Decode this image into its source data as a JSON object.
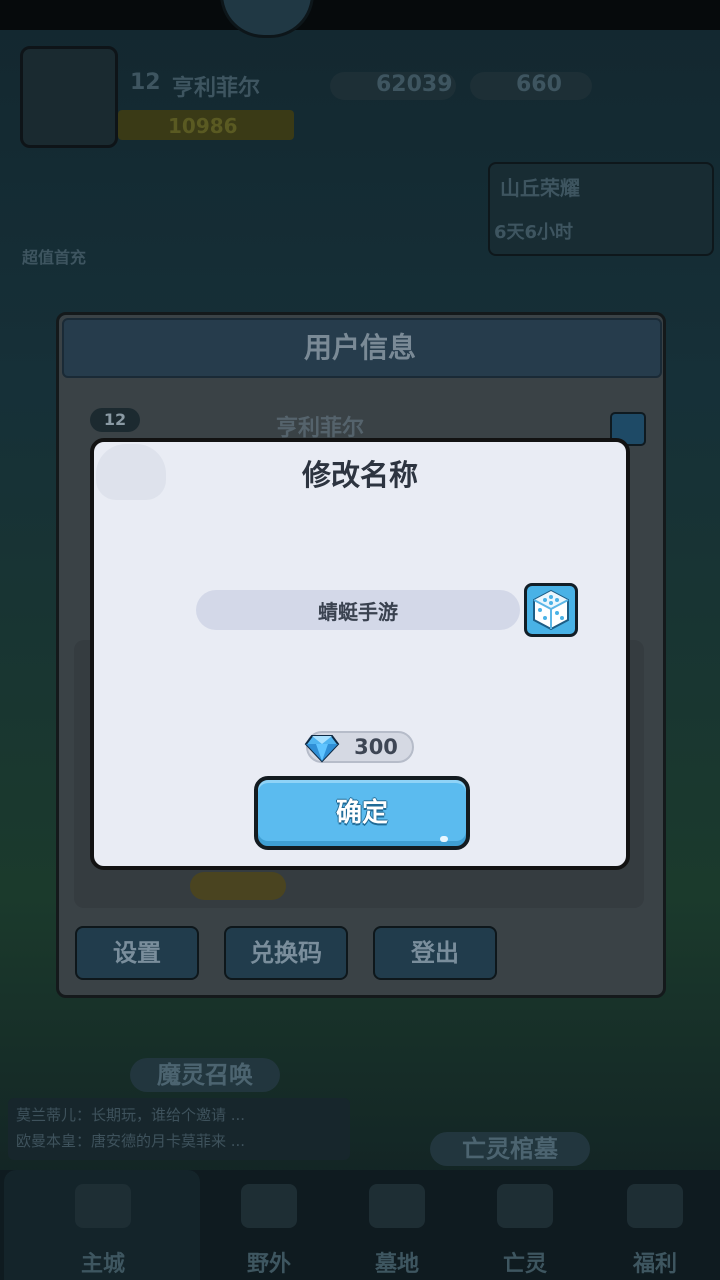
{
  "hud": {
    "level": "12",
    "player_name": "亨利菲尔",
    "power": "10986",
    "gold": "62039",
    "gems": "660",
    "left_event_label": "超值首充",
    "event_title": "山丘荣耀",
    "event_time": "6天6小时"
  },
  "user_panel": {
    "title": "用户信息",
    "level": "12",
    "name": "亨利菲尔",
    "buttons": [
      "设置",
      "兑换码",
      "登出"
    ]
  },
  "rename_dialog": {
    "title": "修改名称",
    "name_value": "蜻蜓手游",
    "cost": "300",
    "confirm_label": "确定",
    "dice_icon": "dice-icon",
    "currency_icon": "gem-icon"
  },
  "bottom": {
    "summon_label": "魔灵召唤",
    "tomb_label": "亡灵棺墓",
    "chat": [
      "莫兰蒂儿：长期玩，谁给个邀请 ...",
      "欧曼本皇：唐安德的月卡莫菲来 ..."
    ],
    "nav": [
      "主城",
      "野外",
      "墓地",
      "亡灵",
      "福利"
    ]
  },
  "colors": {
    "dialog_bg": "#e9ecf4",
    "confirm_bg": "#5bbbef",
    "dice_bg": "#49b2e6",
    "input_bg": "#d3d8e8"
  }
}
